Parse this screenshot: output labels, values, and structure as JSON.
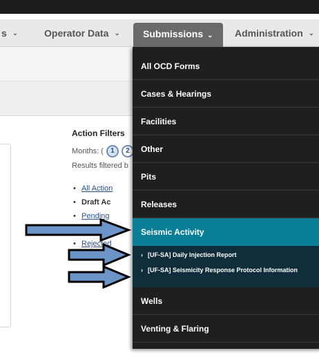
{
  "nav": {
    "partial_label": "s",
    "operator_data": "Operator Data",
    "submissions": "Submissions",
    "administration": "Administration"
  },
  "filters": {
    "title": "Action Filters",
    "months_label": "Months: (",
    "month_1": "1",
    "month_2": "2",
    "results_text": "Results filtered b",
    "links": [
      "All Action",
      "Draft Ac",
      "Pending",
      "",
      "Rejected"
    ]
  },
  "dropdown": {
    "items": [
      "All OCD Forms",
      "Cases & Hearings",
      "Facilities",
      "Other",
      "Pits",
      "Releases",
      "Seismic Activity",
      "Wells",
      "Venting & Flaring"
    ],
    "subitems": [
      "[UF-SA] Daily Injection Report",
      "[UF-SA] Seismicity Response Protocol Information"
    ],
    "chevron": "›"
  },
  "colors": {
    "active_item": "#0a7e97",
    "dropdown_bg": "#1f1f1f",
    "arrow_fill": "#6b94c9"
  },
  "icons": {
    "caret": "caret-down-icon",
    "arrows": "right-arrow-icon"
  }
}
